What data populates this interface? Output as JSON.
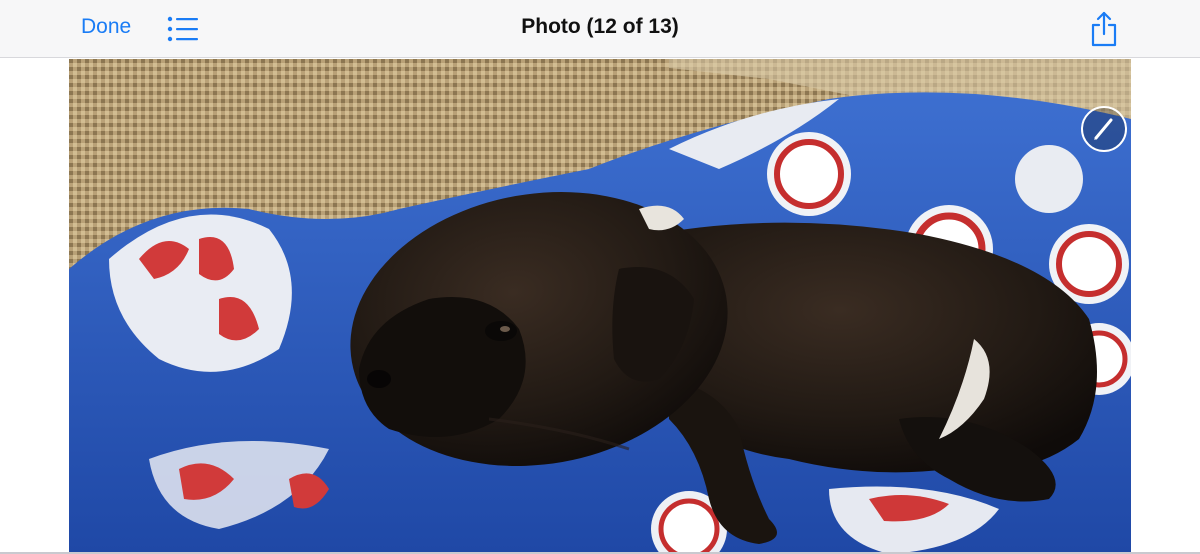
{
  "navbar": {
    "done_label": "Done",
    "title": "Photo (12 of 13)",
    "list_icon": "list-icon",
    "share_icon": "share-icon"
  },
  "photo": {
    "subject_icon": "photo"
  },
  "markup": {
    "icon": "pencil-icon"
  },
  "colors": {
    "accent": "#1a7cf5",
    "navbar_bg": "#f7f7f8"
  }
}
